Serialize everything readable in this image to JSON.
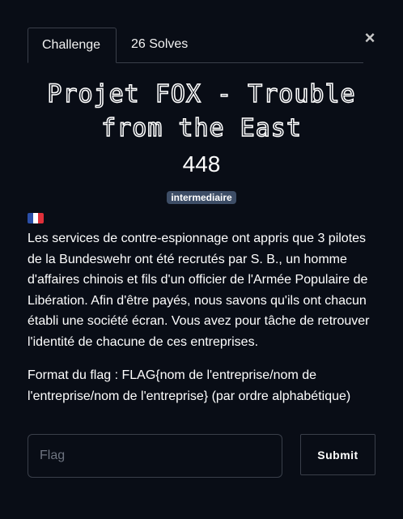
{
  "modal": {
    "close_label": "×"
  },
  "tabs": [
    {
      "label": "Challenge",
      "active": true
    },
    {
      "label": "26 Solves",
      "active": false
    }
  ],
  "challenge": {
    "title": "Projet FOX - Trouble from the East",
    "points": "448",
    "difficulty": "intermediaire",
    "language_icon": "france-flag-icon",
    "description": "Les services de contre-espionnage ont appris que 3 pilotes de la Bundeswehr ont été recrutés par S. B., un homme d'affaires chinois et fils d'un officier de l'Armée Populaire de Libération. Afin d'être payés, nous savons qu'ils ont chacun établi une société écran. Vous avez pour tâche de retrouver l'identité de chacune de ces entreprises.",
    "format": "Format du flag : FLAG{nom de l'entreprise/nom de l'entreprise/nom de l'entreprise} (par ordre alphabétique)"
  },
  "form": {
    "flag_placeholder": "Flag",
    "flag_value": "",
    "submit_label": "Submit"
  },
  "colors": {
    "background": "#090d16",
    "border": "#3a3f4a",
    "badge": "#3d4d66",
    "flag_blue": "#2b4fa8",
    "flag_white": "#ffffff",
    "flag_red": "#e0303a"
  }
}
